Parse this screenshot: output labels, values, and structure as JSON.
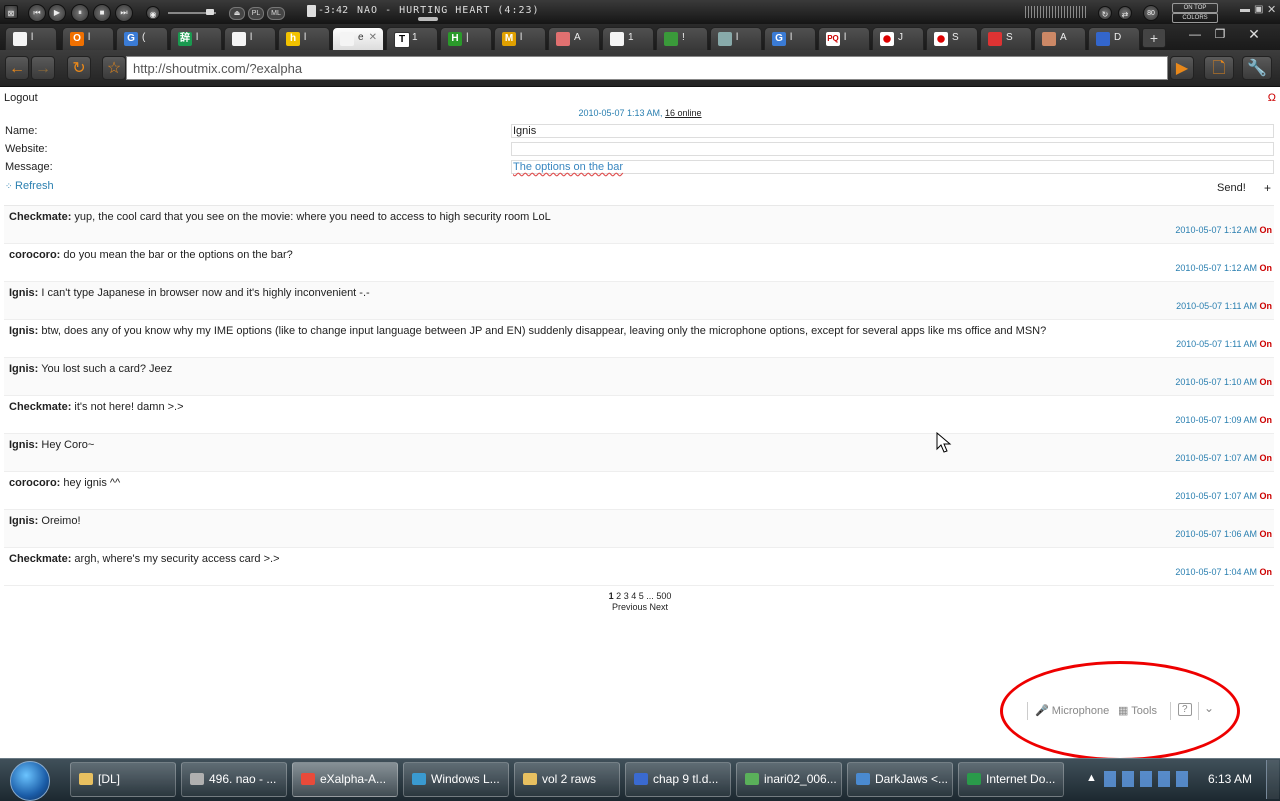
{
  "player": {
    "time": "-3:42",
    "track": "NAO - HURTING HEART (4:23)",
    "buttons": [
      "prev",
      "play",
      "pause",
      "stop",
      "next"
    ],
    "pl_label": "PL",
    "ml_label": "ML",
    "ontop_label": "ON TOP",
    "colors_label": "COLORS",
    "bd_label": "80"
  },
  "browser": {
    "url": "http://shoutmix.com/?exalpha",
    "tab_active_label": "e",
    "tabs": [
      {
        "icon": "doc",
        "color": "#ddd",
        "label": "l"
      },
      {
        "icon": "O",
        "color": "#f07000",
        "label": "l"
      },
      {
        "icon": "G",
        "color": "#3a7bd5",
        "label": "("
      },
      {
        "icon": "辞",
        "color": "#1a9a50",
        "label": "l"
      },
      {
        "icon": "doc",
        "color": "#ddd",
        "label": "l"
      },
      {
        "icon": "h",
        "color": "#f2c200",
        "label": "l"
      },
      {
        "icon": "doc",
        "color": "#ddd",
        "label": "e"
      },
      {
        "icon": "T",
        "color": "#222",
        "label": "1"
      },
      {
        "icon": "H",
        "color": "#2a9a2a",
        "label": "|"
      },
      {
        "icon": "M",
        "color": "#e0a000",
        "label": "l"
      },
      {
        "icon": "img",
        "color": "#e07070",
        "label": "A"
      },
      {
        "icon": "doc",
        "color": "#ddd",
        "label": "1"
      },
      {
        "icon": "img",
        "color": "#3a9a3a",
        "label": "!"
      },
      {
        "icon": "seal",
        "color": "#8aa",
        "label": "l"
      },
      {
        "icon": "G",
        "color": "#3a7bd5",
        "label": "l"
      },
      {
        "icon": "PQ",
        "color": "#fff",
        "label": "l"
      },
      {
        "icon": "jp",
        "color": "#fff",
        "label": "J"
      },
      {
        "icon": "jp",
        "color": "#fff",
        "label": "S"
      },
      {
        "icon": "img",
        "color": "#d33",
        "label": "S"
      },
      {
        "icon": "img",
        "color": "#c86",
        "label": "A"
      },
      {
        "icon": "img",
        "color": "#36c",
        "label": "D"
      }
    ]
  },
  "page": {
    "logout": "Logout",
    "omega": "Ω",
    "stamp_time": "2010-05-07 1:13 AM,",
    "online": "16 online",
    "form": {
      "name_label": "Name:",
      "name_value": "Ignis",
      "website_label": "Website:",
      "website_value": "",
      "message_label": "Message:",
      "message_value": "The options on the bar",
      "refresh": "Refresh",
      "send": "Send!",
      "plus": "+"
    },
    "messages": [
      {
        "nick": "Checkmate:",
        "text": "yup, the cool card that you see on the movie: where you need to access to high security room LoL",
        "time": "2010-05-07 1:12 AM",
        "flag": "On"
      },
      {
        "nick": "corocoro:",
        "text": "do you mean the bar or the options on the bar?",
        "time": "2010-05-07 1:12 AM",
        "flag": "On"
      },
      {
        "nick": "Ignis:",
        "text": "I can't type Japanese in browser now and it's highly inconvenient -.-",
        "time": "2010-05-07 1:11 AM",
        "flag": "On"
      },
      {
        "nick": "Ignis:",
        "text": "btw, does any of you know why my IME options (like to change input language between JP and EN) suddenly disappear, leaving only the microphone options, except for several apps like ms office and MSN?",
        "time": "2010-05-07 1:11 AM",
        "flag": "On"
      },
      {
        "nick": "Ignis:",
        "text": "You lost such a card? Jeez",
        "time": "2010-05-07 1:10 AM",
        "flag": "On"
      },
      {
        "nick": "Checkmate:",
        "text": "it's not here! damn >.>",
        "time": "2010-05-07 1:09 AM",
        "flag": "On"
      },
      {
        "nick": "Ignis:",
        "text": "Hey Coro~",
        "time": "2010-05-07 1:07 AM",
        "flag": "On"
      },
      {
        "nick": "corocoro:",
        "text": "hey ignis ^^",
        "time": "2010-05-07 1:07 AM",
        "flag": "On"
      },
      {
        "nick": "Ignis:",
        "text": "Oreimo!",
        "time": "2010-05-07 1:06 AM",
        "flag": "On"
      },
      {
        "nick": "Checkmate:",
        "text": "argh, where's my security access card >.>",
        "time": "2010-05-07 1:04 AM",
        "flag": "On"
      }
    ],
    "pager": {
      "current": "1",
      "pages": [
        "2",
        "3",
        "4",
        "5"
      ],
      "ellipsis": "...",
      "last": "500",
      "previous": "Previous",
      "next": "Next"
    }
  },
  "ime_bar": {
    "microphone": "Microphone",
    "tools": "Tools",
    "help": "?",
    "options": "⌄"
  },
  "taskbar": {
    "items": [
      {
        "label": "[DL]"
      },
      {
        "label": "496. nao - ..."
      },
      {
        "label": "eXalpha-A..."
      },
      {
        "label": "Windows L..."
      },
      {
        "label": "vol 2 raws"
      },
      {
        "label": "chap 9 tl.d..."
      },
      {
        "label": "inari02_006..."
      },
      {
        "label": "DarkJaws <..."
      },
      {
        "label": "Internet Do..."
      }
    ],
    "clock": "6:13 AM"
  }
}
